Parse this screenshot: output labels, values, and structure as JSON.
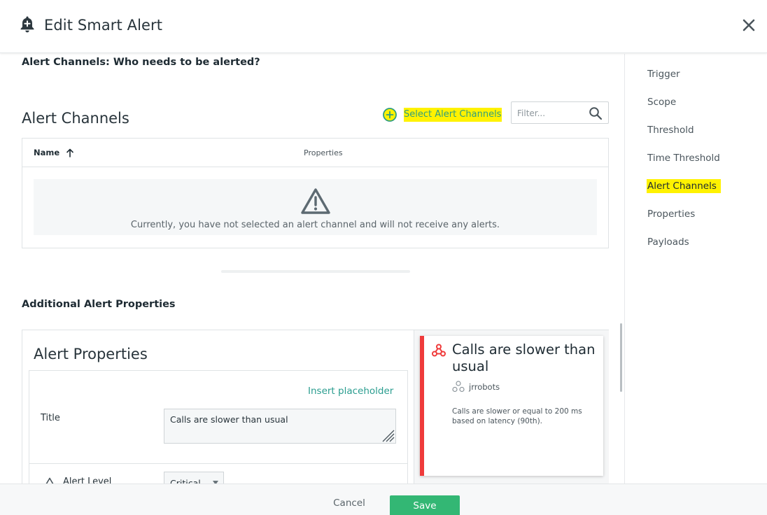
{
  "header": {
    "title": "Edit Smart Alert",
    "icon": "bell-plus-icon",
    "close_icon": "close-icon"
  },
  "alert_channels_section": {
    "heading": "Alert Channels: Who needs to be alerted?",
    "title": "Alert Channels",
    "select_button_label": "Select Alert Channels",
    "filter_placeholder": "Filter...",
    "table": {
      "columns": [
        "Name",
        "Properties"
      ],
      "sort": "Name ascending",
      "empty_message": "Currently, you have not selected an alert channel and will not receive any alerts."
    }
  },
  "additional_section": {
    "heading": "Additional Alert Properties",
    "title": "Alert Properties",
    "insert_placeholder_label": "Insert placeholder",
    "fields": {
      "title_label": "Title",
      "title_value": "Calls are slower than usual",
      "level_label": "Alert Level",
      "level_value": "Critical"
    }
  },
  "preview_card": {
    "title": "Calls are slower than usual",
    "entity": "jrrobots",
    "description": "Calls are slower or equal to 200 ms based on latency (90th).",
    "accent_color": "#ef3b3b"
  },
  "sidebar": {
    "items": [
      {
        "label": "Trigger"
      },
      {
        "label": "Scope"
      },
      {
        "label": "Threshold"
      },
      {
        "label": "Time Threshold"
      },
      {
        "label": "Alert Channels",
        "active": true
      },
      {
        "label": "Properties"
      },
      {
        "label": "Payloads"
      }
    ]
  },
  "footer": {
    "cancel_label": "Cancel",
    "save_label": "Save"
  },
  "colors": {
    "highlight": "#fff200",
    "accent_teal": "#2a9d8f",
    "save_green": "#33b774",
    "critical_red": "#ef3b3b"
  }
}
